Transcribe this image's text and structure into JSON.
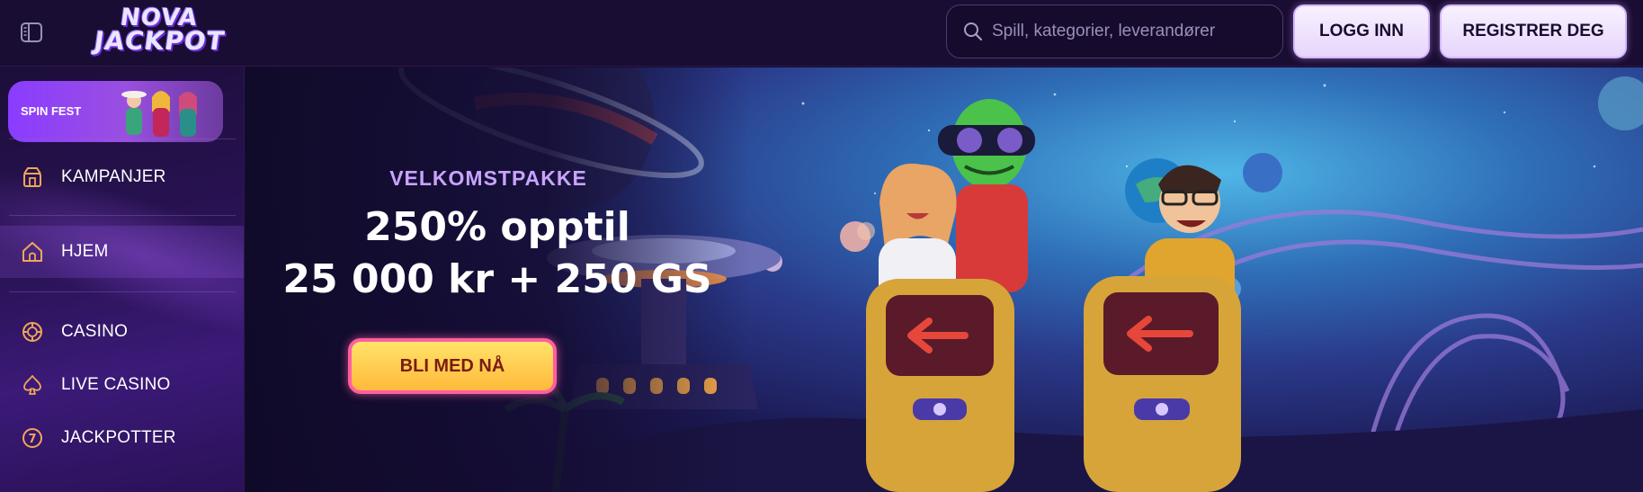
{
  "header": {
    "logo_line1": "NOVA",
    "logo_line2": "JACKPOT",
    "search_placeholder": "Spill, kategorier, leverandører",
    "login_label": "LOGG INN",
    "register_label": "REGISTRER DEG"
  },
  "sidebar": {
    "promo_label": "SPIN FEST",
    "items": [
      {
        "label": "KAMPANJER",
        "icon": "gift-shop-icon"
      },
      {
        "label": "HJEM",
        "icon": "home-icon"
      },
      {
        "label": "CASINO",
        "icon": "casino-chip-icon"
      },
      {
        "label": "LIVE CASINO",
        "icon": "spade-icon"
      },
      {
        "label": "JACKPOTTER",
        "icon": "jackpot-icon"
      }
    ],
    "active_item": "HJEM"
  },
  "hero": {
    "welcome": "VELKOMSTPAKKE",
    "headline1": "250% opptil",
    "headline2": "25 000 kr + 250 GS",
    "cta_label": "BLI MED NÅ"
  },
  "colors": {
    "accent_purple": "#c9a3ff",
    "cta_yellow": "#ffe36a",
    "cta_border": "#ff5fa0",
    "icon_orange": "#f2a65a"
  }
}
